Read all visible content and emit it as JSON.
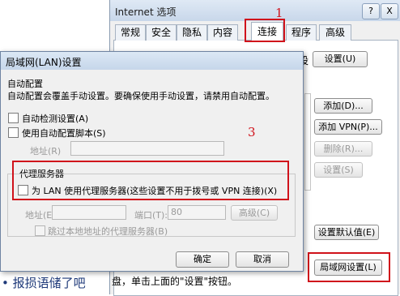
{
  "inet": {
    "title": "Internet 选项",
    "help": "?",
    "close": "X",
    "tabs": [
      {
        "label": "常规"
      },
      {
        "label": "安全"
      },
      {
        "label": "隐私"
      },
      {
        "label": "内容"
      },
      {
        "label": "连接",
        "active": true
      },
      {
        "label": "程序"
      },
      {
        "label": "高级"
      }
    ],
    "side_text": "设",
    "setup_button": "设置(U)",
    "add_button": "添加(D)...",
    "add_vpn_button": "添加 VPN(P)...",
    "remove_button": "删除(R)...",
    "settings_button": "设置(S)",
    "set_default_button": "设置默认值(E)",
    "lan_settings_button": "局域网设置(L)",
    "bottom_text": "盘，单击上面的\"设置\"按钮。"
  },
  "annotations": {
    "mark1": "1",
    "mark3": "3"
  },
  "background_text": {
    "left_fragment": "• 报损语储了吧"
  },
  "lan": {
    "title": "局域网(LAN)设置",
    "auto_config": {
      "heading": "自动配置",
      "description": "自动配置会覆盖手动设置。要确保使用手动设置，请禁用自动配置。",
      "auto_detect_label": "自动检测设置(A)",
      "use_script_label": "使用自动配置脚本(S)",
      "address_label": "地址(R)",
      "address_value": ""
    },
    "proxy": {
      "heading": "代理服务器",
      "use_proxy_label": "为 LAN 使用代理服务器(这些设置不用于拨号或 VPN 连接)(X)",
      "address_label": "地址(E):",
      "address_value": "",
      "port_label": "端口(T):",
      "port_value": "80",
      "advanced_button": "高级(C)",
      "bypass_label": "跳过本地地址的代理服务器(B)"
    },
    "ok_button": "确定",
    "cancel_button": "取消"
  }
}
